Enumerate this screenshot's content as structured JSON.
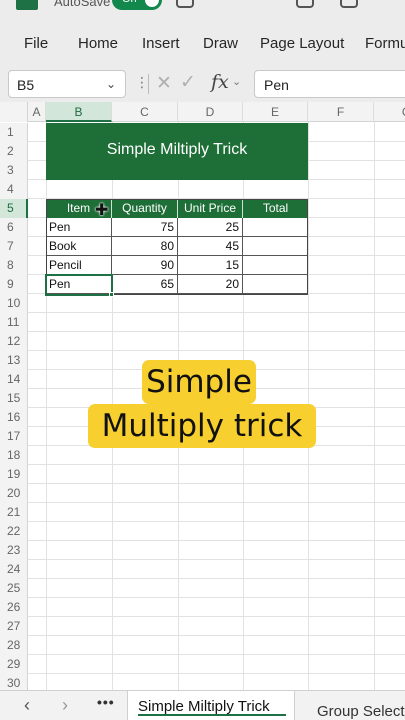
{
  "app": {
    "autosave_label": "AutoSave",
    "autosave_state": "On",
    "accent": "#1e7145"
  },
  "ribbon": {
    "tabs": [
      "File",
      "Home",
      "Insert",
      "Draw",
      "Page Layout",
      "Formu"
    ]
  },
  "formula_bar": {
    "name_box": "B5",
    "formula": "Pen",
    "fx_label": "fx"
  },
  "columns": [
    "A",
    "B",
    "C",
    "D",
    "E",
    "F",
    "G"
  ],
  "rows": [
    "1",
    "2",
    "3",
    "4",
    "5",
    "6",
    "7",
    "8",
    "9",
    "10",
    "11",
    "12",
    "13",
    "14",
    "15",
    "16",
    "17",
    "18",
    "19",
    "20",
    "21",
    "22",
    "23",
    "24",
    "25",
    "26",
    "27",
    "28",
    "29",
    "30"
  ],
  "selected_cell": {
    "column": "B",
    "row": "5"
  },
  "banner": {
    "title": "Simple Miltiply Trick",
    "color": "#1e6e37"
  },
  "table": {
    "headers": [
      "Item",
      "Quantity",
      "Unit Price",
      "Total"
    ],
    "rows": [
      [
        "Pen",
        "75",
        "25",
        ""
      ],
      [
        "Book",
        "80",
        "45",
        ""
      ],
      [
        "Pencil",
        "90",
        "15",
        ""
      ],
      [
        "Pen",
        "65",
        "20",
        ""
      ]
    ]
  },
  "overlay": {
    "line1": "Simple",
    "line2": "Multiply trick",
    "color": "#f7cf2e"
  },
  "sheets": {
    "more_label": "•••",
    "active": "Simple Miltiply Trick",
    "other": "Group Select"
  }
}
